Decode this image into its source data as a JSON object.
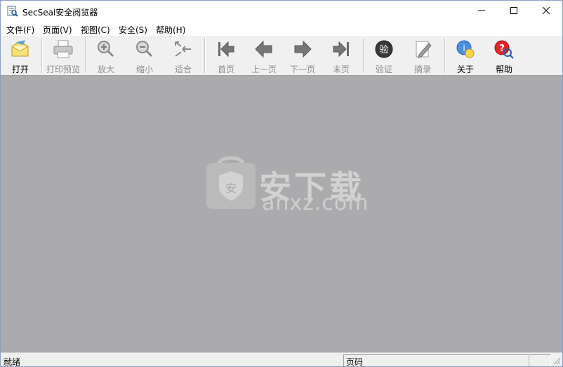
{
  "window": {
    "title": "SecSeal安全阅览器"
  },
  "menu": [
    "文件(F)",
    "页面(V)",
    "视图(C)",
    "安全(S)",
    "帮助(H)"
  ],
  "toolbar": {
    "open": "打开",
    "print_preview": "打印预览",
    "zoom_in": "放大",
    "zoom_out": "缩小",
    "fit": "适合",
    "first_page": "首页",
    "prev_page": "上一页",
    "next_page": "下一页",
    "last_page": "末页",
    "verify": "验证",
    "extract": "摘录",
    "about": "关于",
    "help": "帮助",
    "verify_glyph": "验"
  },
  "watermark": {
    "brand": "安下载",
    "url": "anxz.com",
    "shield_glyph": "安"
  },
  "status": {
    "ready": "就绪",
    "page_label": "页码"
  },
  "colors": {
    "content_bg": "#abaaad",
    "toolbar_bg": "#f0f0f0"
  }
}
